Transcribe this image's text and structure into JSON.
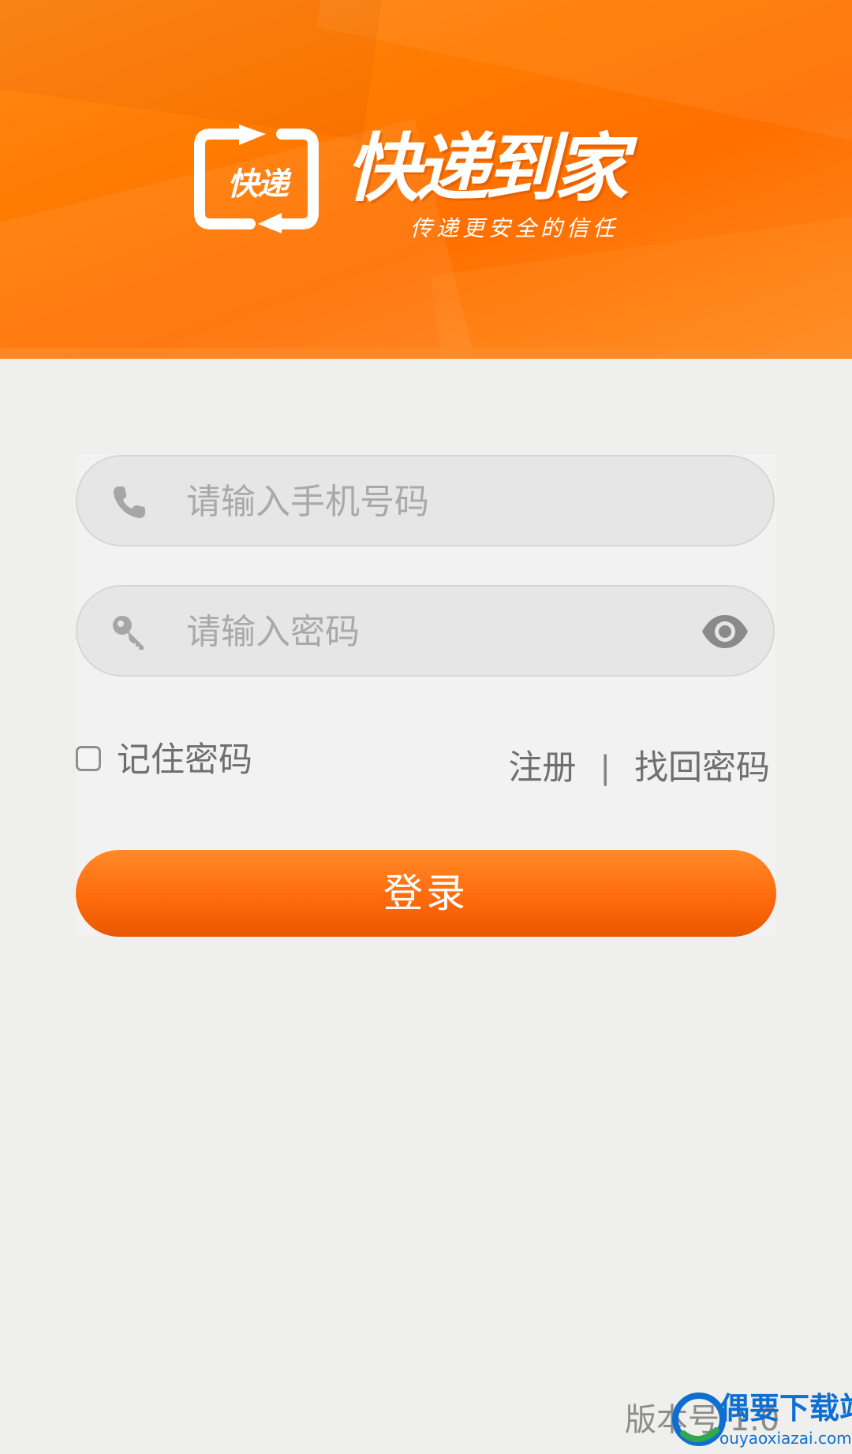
{
  "header": {
    "logo_icon_text": "快递",
    "brand_title": "快递到家",
    "slogan": "传递更安全的信任"
  },
  "form": {
    "phone_placeholder": "请输入手机号码",
    "password_placeholder": "请输入密码",
    "remember_label": "记住密码",
    "remember_checked": false,
    "register_link": "注册",
    "separator": "|",
    "forgot_link": "找回密码",
    "login_button": "登录"
  },
  "footer": {
    "version_text": "版本号 1.0",
    "watermark_title": "偶要下载站",
    "watermark_url": "ouyaoxiazai.com"
  },
  "colors": {
    "brand_orange": "#ff7a00",
    "button_orange": "#ff6a0c",
    "background": "#efefed",
    "input_background": "#e6e6e6",
    "placeholder_text": "#a9a9a9",
    "watermark_blue": "#0e6fd1"
  },
  "icons": {
    "phone": "phone-icon",
    "password": "key-icon",
    "visibility": "eye-icon",
    "logo": "box-logo-icon"
  }
}
